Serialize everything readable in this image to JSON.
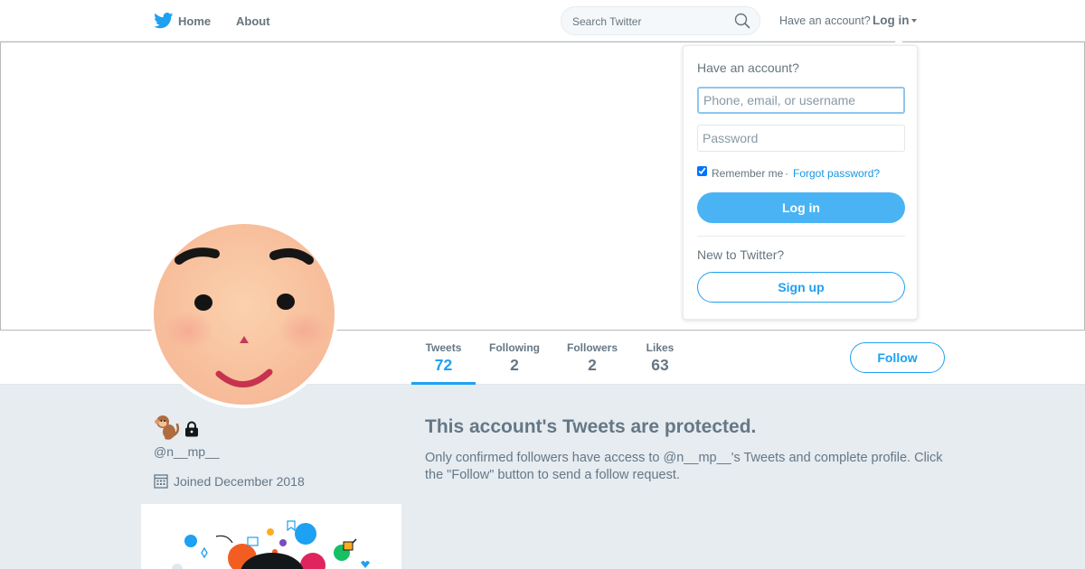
{
  "colors": {
    "brand_blue": "#1da1f2",
    "muted_text": "#657786",
    "page_background": "#e6ecf0",
    "login_button": "#4ab3f4"
  },
  "nav": {
    "logo_icon": "twitter-bird-icon",
    "home_label": "Home",
    "about_label": "About",
    "search_placeholder": "Search Twitter",
    "search_icon": "search-icon",
    "have_account_text": "Have an account?",
    "login_label": "Log in",
    "login_caret_icon": "caret-down-icon"
  },
  "login_dropdown": {
    "title": "Have an account?",
    "username_placeholder": "Phone, email, or username",
    "password_placeholder": "Password",
    "remember_label": "Remember me",
    "separator": "·",
    "forgot_label": "Forgot password?",
    "login_button": "Log in",
    "new_text": "New to Twitter?",
    "signup_button": "Sign up"
  },
  "profile": {
    "avatar_icon": "smiling-face-avatar",
    "name_icons": [
      "monkey-emoji-icon",
      "lock-icon"
    ],
    "handle": "@n__mp__",
    "calendar_icon": "calendar-icon",
    "joined": "Joined December 2018",
    "follow_button": "Follow"
  },
  "stats": [
    {
      "label": "Tweets",
      "value": "72",
      "active": true
    },
    {
      "label": "Following",
      "value": "2",
      "active": false
    },
    {
      "label": "Followers",
      "value": "2",
      "active": false
    },
    {
      "label": "Likes",
      "value": "63",
      "active": false
    }
  ],
  "protected": {
    "title": "This account's Tweets are protected.",
    "description": "Only confirmed followers have access to @n__mp__'s Tweets and complete profile. Click the \"Follow\" button to send a follow request."
  }
}
